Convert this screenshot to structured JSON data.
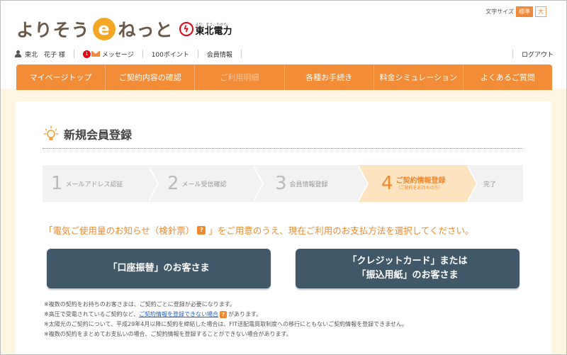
{
  "brand": {
    "logo_pre": "よりそう",
    "logo_e": "e",
    "logo_post": "ねっと",
    "tohoku_tagline": "より、そう、ちから。",
    "tohoku_name": "東北電力"
  },
  "font_size": {
    "label": "文字サイズ",
    "standard": "標準",
    "large": "大"
  },
  "user_bar": {
    "user_name": "東北　花子 様",
    "message_count": "1",
    "message_label": "メッセージ",
    "points": "100ポイント",
    "member_info": "会員情報",
    "logout": "ログアウト"
  },
  "nav": {
    "items": [
      {
        "label": "マイページトップ"
      },
      {
        "label": "ご契約内容の確認"
      },
      {
        "label": "ご利用明細"
      },
      {
        "label": "各種お手続き"
      },
      {
        "label": "料金シミュレーション"
      },
      {
        "label": "よくあるご質問"
      }
    ]
  },
  "page": {
    "title": "新規会員登録"
  },
  "steps": [
    {
      "num": "1",
      "label": "メールアドレス認証"
    },
    {
      "num": "2",
      "label": "メール受信確認"
    },
    {
      "num": "3",
      "label": "会員情報登録"
    },
    {
      "num": "4",
      "label": "ご契約情報登録",
      "sub": "（ご契約をお持ちの方）"
    },
    {
      "label": "完了"
    }
  ],
  "instruction": {
    "part1": "「電気ご使用量のお知らせ（検針票）",
    "help": "?",
    "part2": "」をご用意のうえ、現在ご利用のお支払方法を選択してください。"
  },
  "buttons": {
    "bank": "「口座振替」のお客さま",
    "card_line1": "「クレジットカード」または",
    "card_line2": "「振込用紙」のお客さま"
  },
  "notes": {
    "n1": "※複数の契約をお持ちのお客さまは、ご契約ごとに登録が必要になります。",
    "n2_pre": "※高圧で受電されているご契約など、",
    "n2_link": "ご契約情報を登録できない場合",
    "n2_post": "があります。",
    "n3": "※太陽光のご契約について、平成29年4月以降に契約を締結した場合は、FIT送配電買取制度への移行にともないご契約情報を登録できません。",
    "n4": "※複数の契約をまとめてお支払いの場合、ご契約情報を登録することができない場合があります。"
  }
}
